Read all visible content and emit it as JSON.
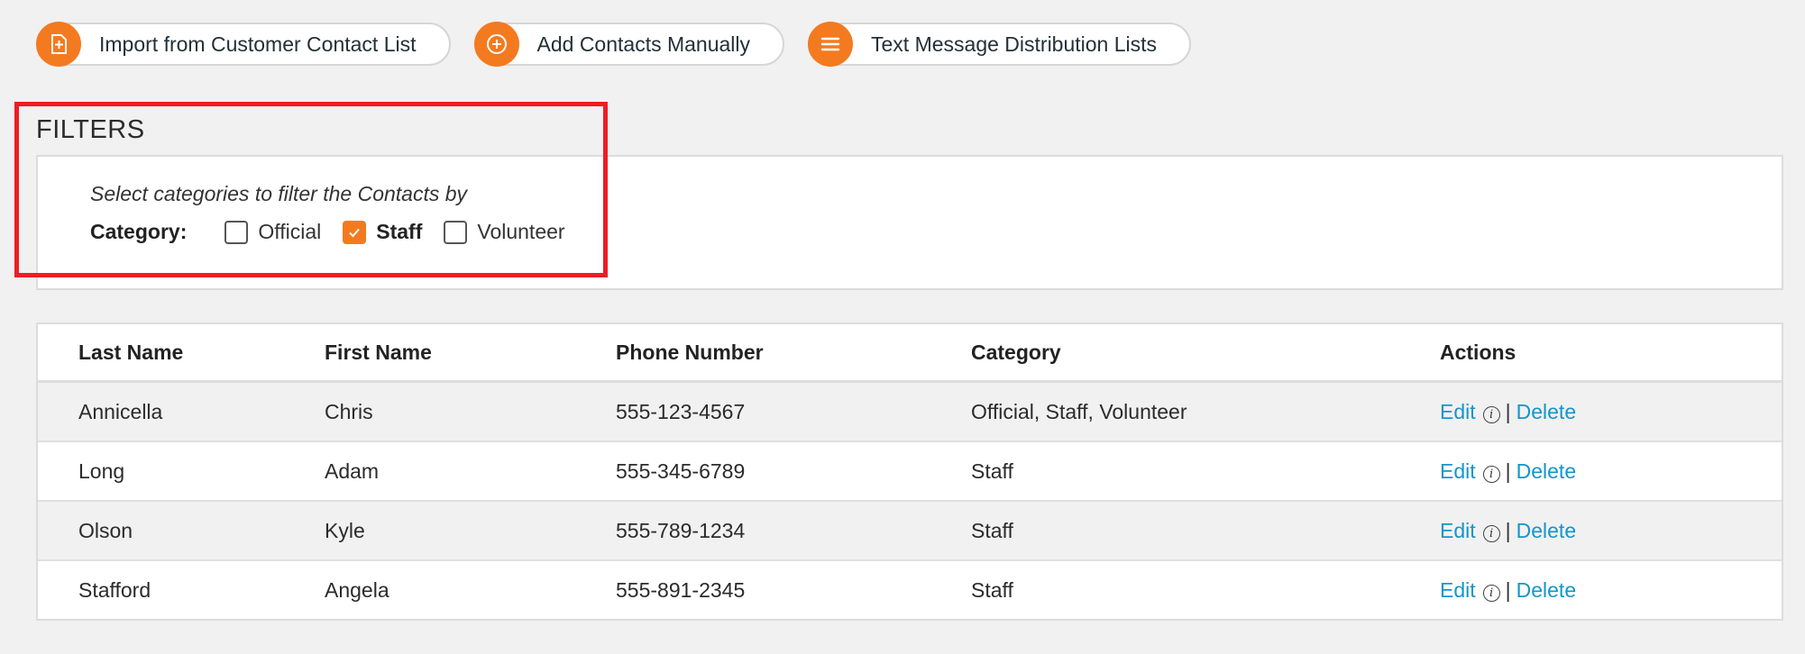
{
  "toolbar": {
    "buttons": [
      {
        "label": "Import from Customer Contact List",
        "icon": "import-icon"
      },
      {
        "label": "Add Contacts Manually",
        "icon": "plus-circle-icon"
      },
      {
        "label": "Text Message Distribution Lists",
        "icon": "list-icon"
      }
    ]
  },
  "filters": {
    "title": "FILTERS",
    "hint": "Select categories to filter the Contacts by",
    "category_label": "Category:",
    "options": [
      {
        "label": "Official",
        "checked": false
      },
      {
        "label": "Staff",
        "checked": true
      },
      {
        "label": "Volunteer",
        "checked": false
      }
    ]
  },
  "table": {
    "headers": [
      "Last Name",
      "First Name",
      "Phone Number",
      "Category",
      "Actions"
    ],
    "rows": [
      {
        "last": "Annicella",
        "first": "Chris",
        "phone": "555-123-4567",
        "category": "Official, Staff, Volunteer"
      },
      {
        "last": "Long",
        "first": "Adam",
        "phone": "555-345-6789",
        "category": "Staff"
      },
      {
        "last": "Olson",
        "first": "Kyle",
        "phone": "555-789-1234",
        "category": "Staff"
      },
      {
        "last": "Stafford",
        "first": "Angela",
        "phone": "555-891-2345",
        "category": "Staff"
      }
    ],
    "edit_label": "Edit",
    "delete_label": "Delete",
    "separator": "|"
  },
  "colors": {
    "accent": "#f47a20",
    "link": "#1496c8",
    "highlight": "#ee1c25"
  }
}
